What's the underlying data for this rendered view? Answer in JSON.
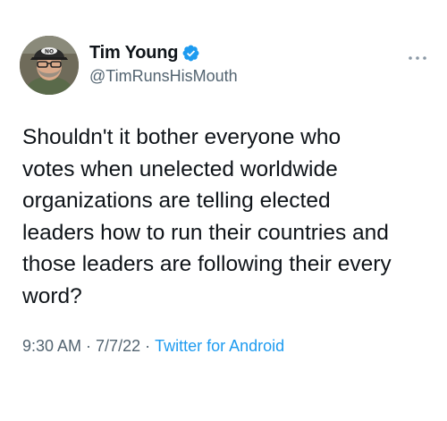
{
  "user": {
    "display_name": "Tim Young",
    "handle": "@TimRunsHisMouth",
    "verified": true,
    "avatar_icon": "profile-photo"
  },
  "tweet": {
    "text": "Shouldn't it bother everyone who\nvotes when unelected worldwide\norganizations are telling elected\nleaders how to run their countries and\nthose leaders are following their every\nword?"
  },
  "meta": {
    "time": "9:30 AM",
    "separator": "·",
    "date": "7/7/22",
    "source": "Twitter for Android"
  },
  "icons": {
    "more": "more-horizontal-icon",
    "verified": "verified-badge-icon"
  },
  "colors": {
    "text": "#0f1419",
    "secondary": "#536471",
    "accent": "#1d9bf0"
  }
}
